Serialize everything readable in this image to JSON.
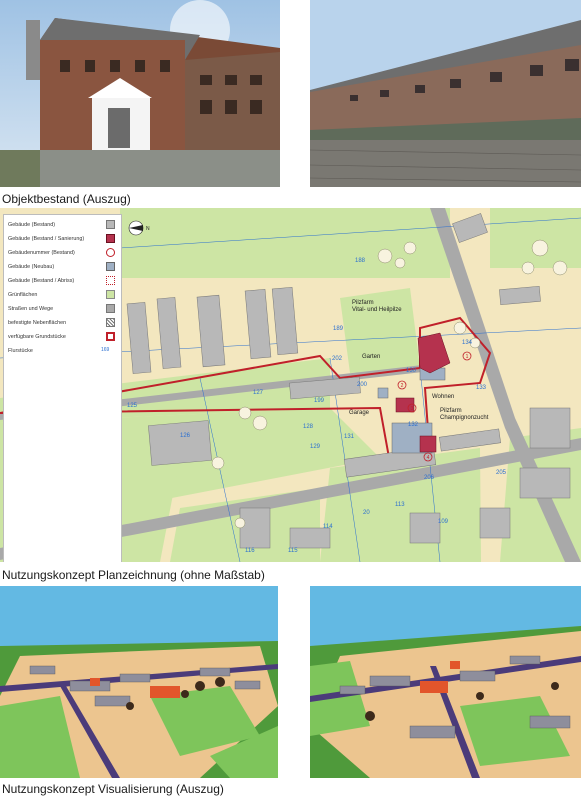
{
  "captions": {
    "objektbestand": "Objektbestand (Auszug)",
    "planzeichnung": "Nutzungskonzept Planzeichnung (ohne Maßstab)",
    "visualisierung": "Nutzungskonzept Visualisierung (Auszug)"
  },
  "legend": {
    "items": [
      {
        "label": "Gebäude (Bestand)",
        "symbol": "grey-square"
      },
      {
        "label": "Gebäude (Bestand / Sanierung)",
        "symbol": "red-square"
      },
      {
        "label": "Gebäudenummer (Bestand)",
        "symbol": "circled-number"
      },
      {
        "label": "Gebäude (Neubau)",
        "symbol": "blue-grey-square"
      },
      {
        "label": "Gebäude (Bestand / Abriss)",
        "symbol": "dotted-square"
      },
      {
        "label": "Grünflächen",
        "symbol": "green-square"
      },
      {
        "label": "Straßen und Wege",
        "symbol": "dark-grey-square"
      },
      {
        "label": "befestigte Nebenflächen",
        "symbol": "hatched-square"
      },
      {
        "label": "verfügbare Grundstücke",
        "symbol": "red-outline-square"
      },
      {
        "label": "Flurstücke",
        "symbol": "parcel-line"
      }
    ],
    "parcel_example": "169"
  },
  "map_labels": {
    "pilzfarm_vital": "Pilzfarm\nVital- und Heilpilze",
    "garten": "Garten",
    "wohnen": "Wohnen",
    "garage": "Garage",
    "pilzfarm_champ": "Pilzfarm\nChampignonzucht"
  },
  "parcels": [
    "188",
    "189",
    "202",
    "200",
    "199",
    "127",
    "125",
    "126",
    "128",
    "129",
    "131",
    "130",
    "132",
    "133",
    "134",
    "206",
    "205",
    "113",
    "109",
    "114",
    "116",
    "115",
    "20"
  ],
  "building_numbers": [
    "1",
    "2",
    "3",
    "4"
  ],
  "colors": {
    "map_bg": "#f3e7bf",
    "green": "#cde5a4",
    "building": "#b8b8b8",
    "building_red": "#b5324e",
    "road": "#a9a9a9",
    "parcel_line": "#2a6fd0",
    "available": "#c0202a",
    "sky": "#63b9e3"
  },
  "icons": [
    "north-arrow-icon"
  ]
}
